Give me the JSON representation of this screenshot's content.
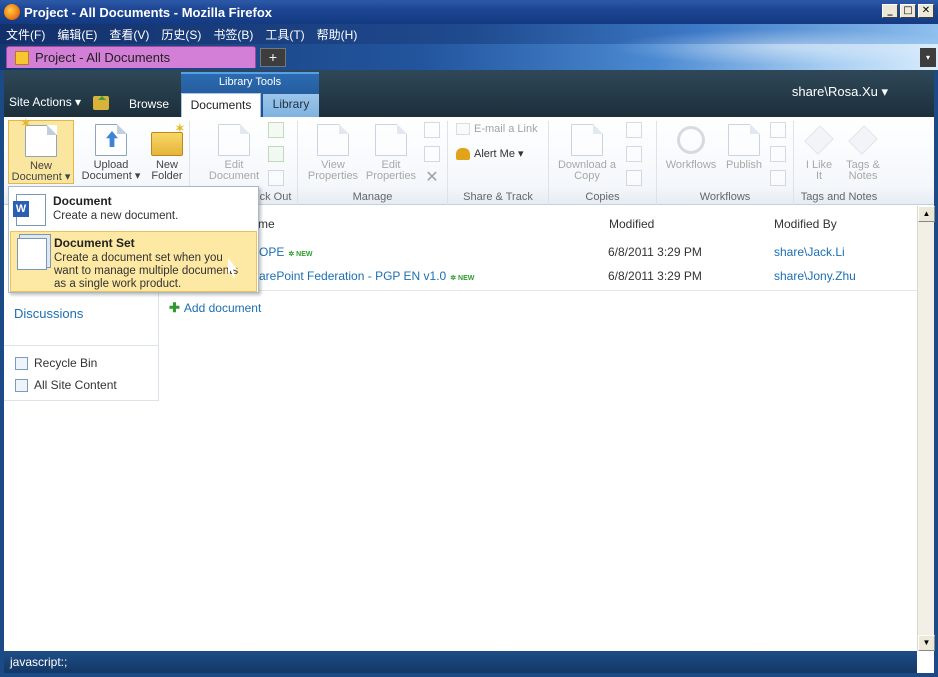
{
  "window": {
    "title": "Project - All Documents - Mozilla Firefox",
    "min": "_",
    "max": "□",
    "close": "✕"
  },
  "menubar": [
    "文件(F)",
    "编辑(E)",
    "查看(V)",
    "历史(S)",
    "书签(B)",
    "工具(T)",
    "帮助(H)"
  ],
  "browser_tab": {
    "title": "Project - All Documents",
    "new_tab": "+",
    "dropdown": "▾"
  },
  "sp": {
    "site_actions": "Site Actions ▾",
    "browse": "Browse",
    "context_group": "Library Tools",
    "tab_documents": "Documents",
    "tab_library": "Library",
    "user": "share\\Rosa.Xu ▾"
  },
  "ribbon": {
    "new_doc": [
      "New",
      "Document ▾"
    ],
    "upload": [
      "Upload",
      "Document ▾"
    ],
    "new_folder": [
      "New",
      "Folder"
    ],
    "edit_doc": [
      "Edit",
      "Document"
    ],
    "check_out_label": "ck Out",
    "view_props": [
      "View",
      "Properties"
    ],
    "edit_props": [
      "Edit",
      "Properties"
    ],
    "manage_label": "Manage",
    "email_link": "E-mail a Link",
    "alert_me": "Alert Me ▾",
    "share_label": "Share & Track",
    "download_copy": [
      "Download a",
      "Copy"
    ],
    "copies_label": "Copies",
    "workflows": "Workflows",
    "publish": "Publish",
    "workflows_label": "Workflows",
    "i_like_it": [
      "I Like",
      "It"
    ],
    "tags_notes": [
      "Tags &",
      "Notes"
    ],
    "tags_label": "Tags and Notes"
  },
  "dropdown": {
    "item1": {
      "title": "Document",
      "desc": "Create a new document."
    },
    "item2": {
      "title": "Document Set",
      "desc": "Create a document set when you want to manage multiple documents as a single work product."
    }
  },
  "list": {
    "headers": {
      "name": "me",
      "modified": "Modified",
      "modified_by": "Modified By"
    },
    "rows": [
      {
        "name": "OPE",
        "badge": "✲ NEW",
        "modified": "6/8/2011 3:29 PM",
        "by": "share\\Jack.Li"
      },
      {
        "name": "arePoint Federation - PGP EN v1.0",
        "badge": "✲ NEW",
        "modified": "6/8/2011 3:29 PM",
        "by": "share\\Jony.Zhu"
      }
    ],
    "add": "Add document"
  },
  "leftnav": {
    "discussions": "Discussions",
    "recycle_bin": "Recycle Bin",
    "all_content": "All Site Content"
  },
  "status": "javascript:;",
  "scroll": {
    "up": "▲",
    "down": "▼"
  }
}
